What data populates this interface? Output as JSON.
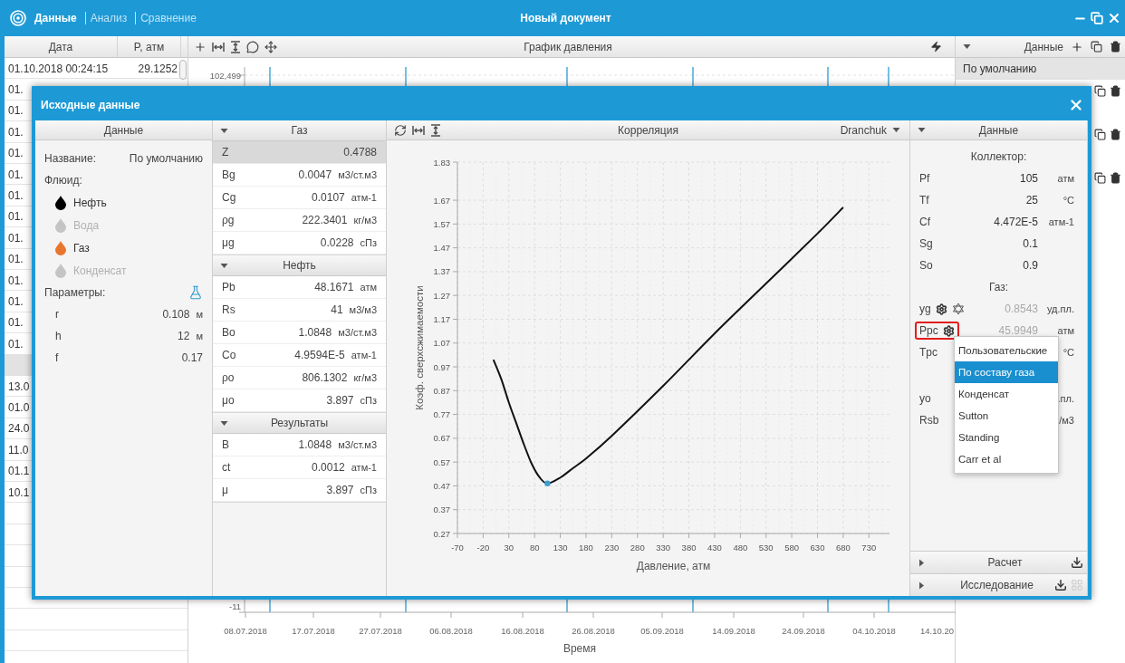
{
  "app": {
    "tabs": [
      {
        "label": "Данные",
        "selected": true
      },
      {
        "label": "Анализ",
        "selected": false
      },
      {
        "label": "Сравнение",
        "selected": false
      }
    ],
    "title": "Новый документ"
  },
  "table": {
    "columns": [
      "Дата",
      "P, атм"
    ],
    "rows": [
      {
        "kind": "row",
        "cells": [
          "01.10.2018 00:24:15",
          "29.1252"
        ]
      },
      {
        "kind": "row",
        "cells": [
          "01."
        ]
      },
      {
        "kind": "row",
        "cells": [
          "01."
        ]
      },
      {
        "kind": "row",
        "cells": [
          "01."
        ]
      },
      {
        "kind": "row",
        "cells": [
          "01."
        ]
      },
      {
        "kind": "row",
        "cells": [
          "01."
        ]
      },
      {
        "kind": "row",
        "cells": [
          "01."
        ]
      },
      {
        "kind": "row",
        "cells": [
          "01."
        ]
      },
      {
        "kind": "row",
        "cells": [
          "01."
        ]
      },
      {
        "kind": "row",
        "cells": [
          "01."
        ]
      },
      {
        "kind": "row",
        "cells": [
          "01."
        ]
      },
      {
        "kind": "row",
        "cells": [
          "01."
        ]
      },
      {
        "kind": "row",
        "cells": [
          "01."
        ]
      },
      {
        "kind": "row",
        "cells": [
          "01."
        ]
      },
      {
        "kind": "group"
      },
      {
        "kind": "row",
        "cells": [
          "13.0"
        ]
      },
      {
        "kind": "row",
        "cells": [
          "01.0"
        ]
      },
      {
        "kind": "row",
        "cells": [
          "24.0"
        ]
      },
      {
        "kind": "row",
        "cells": [
          "11.0"
        ]
      },
      {
        "kind": "row",
        "cells": [
          "01.1"
        ]
      },
      {
        "kind": "row",
        "cells": [
          "10.1"
        ]
      }
    ]
  },
  "pressure_chart": {
    "title": "График давления",
    "y_ticks": [
      "102,499",
      "-11"
    ],
    "x_ticks": [
      "08.07.2018",
      "17.07.2018",
      "27.07.2018",
      "06.08.2018",
      "16.08.2018",
      "26.08.2018",
      "05.09.2018",
      "14.09.2018",
      "24.09.2018",
      "04.10.2018",
      "14.10.20"
    ],
    "xlabel": "Время"
  },
  "profiles": {
    "title": "Данные",
    "items": [
      {
        "label": "По умолчанию",
        "selected": true
      }
    ]
  },
  "dialog": {
    "title": "Исходные данные",
    "source": {
      "title": "Данные",
      "name_label": "Название:",
      "name_value": "По умолчанию",
      "fluid_label": "Флюид:",
      "fluids": [
        {
          "label": "Нефть",
          "on": true,
          "color": "#000000"
        },
        {
          "label": "Вода",
          "on": false,
          "color": "#c4c4c4"
        },
        {
          "label": "Газ",
          "on": true,
          "color": "#e8762d"
        },
        {
          "label": "Конденсат",
          "on": false,
          "color": "#c4c4c4"
        }
      ],
      "params_label": "Параметры:",
      "params": [
        {
          "label": "r",
          "value": "0.108",
          "unit": "м"
        },
        {
          "label": "h",
          "value": "12",
          "unit": "м"
        },
        {
          "label": "f",
          "value": "0.17"
        }
      ]
    },
    "properties": {
      "sections": [
        {
          "title": "Газ",
          "expanded": true,
          "rows": [
            {
              "label": "Z",
              "value": "0.4788",
              "selected": true
            },
            {
              "label": "Bg",
              "value": "0.0047",
              "unit": "м3/ст.м3",
              "selected": false
            },
            {
              "label": "Cg",
              "value": "0.0107",
              "unit": "атм-1",
              "selected": false
            },
            {
              "label": "ρg",
              "value": "222.3401",
              "unit": "кг/м3",
              "selected": false
            },
            {
              "label": "μg",
              "value": "0.0228",
              "unit": "сПз",
              "selected": false
            }
          ]
        },
        {
          "title": "Нефть",
          "expanded": true,
          "rows": [
            {
              "label": "Pb",
              "value": "48.1671",
              "unit": "атм",
              "selected": false
            },
            {
              "label": "Rs",
              "value": "41",
              "unit": "м3/м3",
              "selected": false
            },
            {
              "label": "Bo",
              "value": "1.0848",
              "unit": "м3/ст.м3",
              "selected": false
            },
            {
              "label": "Co",
              "value": "4.9594E-5",
              "unit": "атм-1",
              "selected": false
            },
            {
              "label": "ρo",
              "value": "806.1302",
              "unit": "кг/м3",
              "selected": false
            },
            {
              "label": "μo",
              "value": "3.897",
              "unit": "сПз",
              "selected": false
            }
          ]
        },
        {
          "title": "Результаты",
          "expanded": true,
          "rows": [
            {
              "label": "B",
              "value": "1.0848",
              "unit": "м3/ст.м3",
              "selected": false
            },
            {
              "label": "ct",
              "value": "0.0012",
              "unit": "атм-1",
              "selected": false
            },
            {
              "label": "μ",
              "value": "3.897",
              "unit": "сПз",
              "selected": false
            }
          ]
        }
      ]
    },
    "correlation": {
      "title": "Корреляция",
      "method": "Dranchuk",
      "chart_data": {
        "type": "line",
        "xlabel": "Давление, атм",
        "ylabel": "Коэф. сверхсжимаемости",
        "x": [
          0,
          15,
          30,
          45,
          60,
          75,
          90,
          105,
          130,
          155,
          180,
          230,
          330,
          430,
          530,
          630,
          680
        ],
        "series": [
          {
            "color": "#111111",
            "values": [
              1.0,
              0.92,
              0.82,
              0.73,
              0.64,
              0.56,
              0.505,
              0.48,
              0.505,
              0.545,
              0.585,
              0.68,
              0.89,
              1.11,
              1.32,
              1.53,
              1.64
            ]
          }
        ],
        "xlim": [
          -70,
          770
        ],
        "ylim": [
          0.27,
          1.83
        ],
        "xticks": [
          -70,
          -20,
          30,
          80,
          130,
          180,
          230,
          280,
          330,
          380,
          430,
          480,
          530,
          580,
          630,
          680,
          730
        ],
        "yticks": [
          0.27,
          0.37,
          0.47,
          0.57,
          0.67,
          0.77,
          0.87,
          0.97,
          1.07,
          1.17,
          1.27,
          1.37,
          1.47,
          1.57,
          1.67,
          1.83
        ],
        "grid": true
      }
    },
    "data": {
      "title": "Данные",
      "expanded": true,
      "groups": [
        {
          "heading": "Коллектор:",
          "rows": [
            {
              "kind": "value",
              "label": "Pf",
              "value": "105",
              "unit": "атм",
              "muted": false,
              "highlighted": false
            },
            {
              "kind": "value",
              "label": "Tf",
              "value": "25",
              "unit": "°C",
              "muted": false,
              "highlighted": false
            },
            {
              "kind": "value",
              "label": "Cf",
              "value": "4.472E-5",
              "unit": "атм-1",
              "muted": false,
              "highlighted": false
            },
            {
              "kind": "value",
              "label": "Sg",
              "value": "0.1",
              "muted": false,
              "highlighted": false
            },
            {
              "kind": "value",
              "label": "So",
              "value": "0.9",
              "muted": false,
              "highlighted": false
            }
          ]
        },
        {
          "heading": "Газ:",
          "rows": [
            {
              "kind": "method-calc",
              "label": "yg",
              "value": "0.8543",
              "unit": "уд.пл.",
              "muted": true,
              "highlighted": false
            },
            {
              "kind": "method",
              "label": "Ppc",
              "value": "45.9949",
              "unit": "атм",
              "muted": true,
              "highlighted": true,
              "menu": [
                {
                  "label": "Пользовательские",
                  "selected": false
                },
                {
                  "label": "По составу газа",
                  "selected": true
                },
                {
                  "label": "Конденсат",
                  "selected": false
                },
                {
                  "label": "Sutton",
                  "selected": false
                },
                {
                  "label": "Standing",
                  "selected": false
                },
                {
                  "label": "Carr et al",
                  "selected": false
                }
              ]
            },
            {
              "kind": "value",
              "label": "Tpc",
              "unit": "°C",
              "highlighted": false
            },
            {
              "kind": "spacer"
            },
            {
              "kind": "value",
              "label": "yo",
              "unit": ".пл.",
              "highlighted": false
            },
            {
              "kind": "value",
              "label": "Rsb",
              "unit": "/м3",
              "highlighted": false
            }
          ]
        }
      ],
      "footer": [
        {
          "title": "Расчет",
          "expanded": false,
          "kind": "download"
        },
        {
          "title": "Исследование",
          "expanded": false,
          "kind": "download-grid"
        }
      ]
    }
  }
}
